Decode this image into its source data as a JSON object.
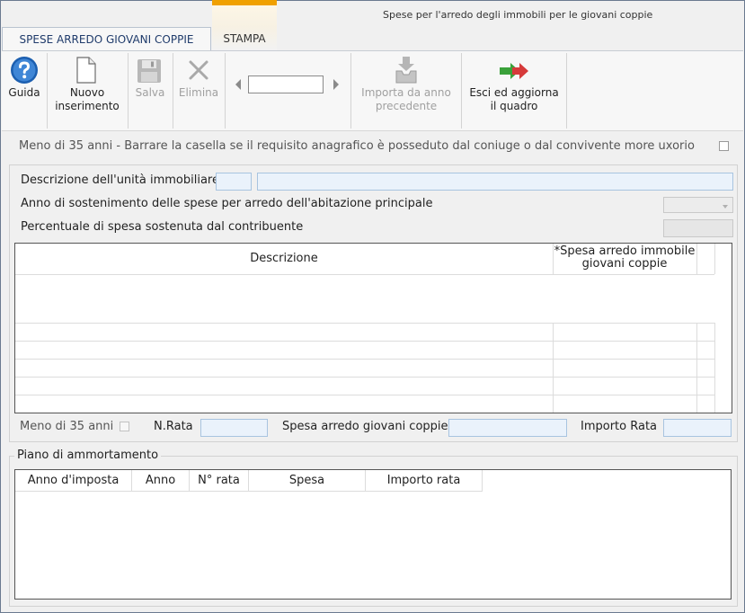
{
  "window": {
    "title": "Spese per l'arredo degli immobili per le giovani coppie"
  },
  "tabs": [
    {
      "label": "SPESE ARREDO GIOVANI COPPIE",
      "active": true
    },
    {
      "label": "STAMPA",
      "active": false
    }
  ],
  "toolbar": {
    "guida": "Guida",
    "nuovo_line1": "Nuovo",
    "nuovo_line2": "inserimento",
    "salva": "Salva",
    "elimina": "Elimina",
    "nav_value": "",
    "importa_line1": "Importa da anno",
    "importa_line2": "precedente",
    "esci_line1": "Esci ed aggiorna",
    "esci_line2": "il quadro"
  },
  "form": {
    "under35_spouse_label": "Meno di 35 anni - Barrare la casella se il requisito anagrafico è posseduto dal coniuge o dal convivente more uxorio",
    "descrizione_label": "Descrizione dell'unità immobiliare",
    "descrizione_code": "",
    "descrizione_value": "",
    "anno_label": "Anno di sostenimento delle spese per arredo dell'abitazione principale",
    "anno_value": "",
    "percentuale_label": "Percentuale di spesa sostenuta dal contribuente",
    "percentuale_value": ""
  },
  "expenses_table": {
    "columns": [
      "Descrizione",
      "*Spesa arredo immobile giovani coppie"
    ],
    "rows": []
  },
  "bottom_fields": {
    "under35_label": "Meno di 35 anni",
    "nrata_label": "N.Rata",
    "nrata_value": "",
    "spesa_label": "Spesa arredo giovani coppie",
    "spesa_value": "",
    "importo_label": "Importo Rata",
    "importo_value": ""
  },
  "piano": {
    "title": "Piano di ammortamento",
    "columns": [
      "Anno d'imposta",
      "Anno",
      "N° rata",
      "Spesa",
      "Importo rata"
    ],
    "rows": []
  },
  "colors": {
    "accent_tab": "#f0a000",
    "field_blue": "#eaf2fb",
    "help_blue": "#1c5fb0",
    "exit_green": "#3aa13a",
    "exit_red": "#d63a3a"
  }
}
